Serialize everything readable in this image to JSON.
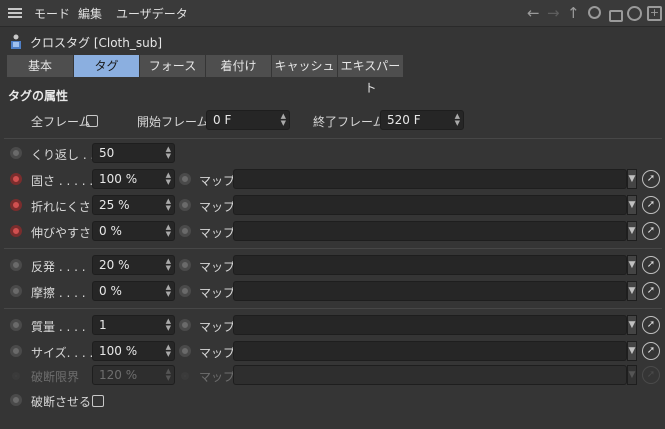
{
  "menu": {
    "items": [
      "モード",
      "編集",
      "ユーザデータ"
    ]
  },
  "nav": {
    "back": "←",
    "forward": "→",
    "up": "↑",
    "search": "🔍",
    "lock": "🔒",
    "target": "◎",
    "add": "⊞"
  },
  "title": "クロスタグ [Cloth_sub]",
  "tabs": [
    "基本",
    "タグ",
    "フォース",
    "着付け",
    "キャッシュ",
    "エキスパート"
  ],
  "section": "タグの属性",
  "attrs": {
    "all_frames_label": "全フレーム",
    "start_label": "開始フレーム",
    "start_value": "0 F",
    "end_label": "終了フレーム",
    "end_value": "520 F"
  },
  "map_label": "マップ",
  "params": {
    "iterations": {
      "label": "くり返し . .",
      "value": "50"
    },
    "stiffness": {
      "label": "固さ . . . . .",
      "value": "100 %"
    },
    "flexion": {
      "label": "折れにくさ",
      "value": "25 %"
    },
    "rubber": {
      "label": "伸びやすさ",
      "value": "0 %"
    },
    "bounce": {
      "label": "反発 . . . .",
      "value": "20 %"
    },
    "friction": {
      "label": "摩擦 . . . .",
      "value": "0 %"
    },
    "mass": {
      "label": "質量 . . . .",
      "value": "1"
    },
    "size": {
      "label": "サイズ. . . .",
      "value": "100 %"
    },
    "tear_limit": {
      "label": "破断限界",
      "value": "120 %"
    },
    "tear": {
      "label": "破断させる"
    }
  },
  "colors": {
    "accent_tab": "#8bafe0",
    "animated_dot": "#d05050",
    "background": "#353535"
  }
}
